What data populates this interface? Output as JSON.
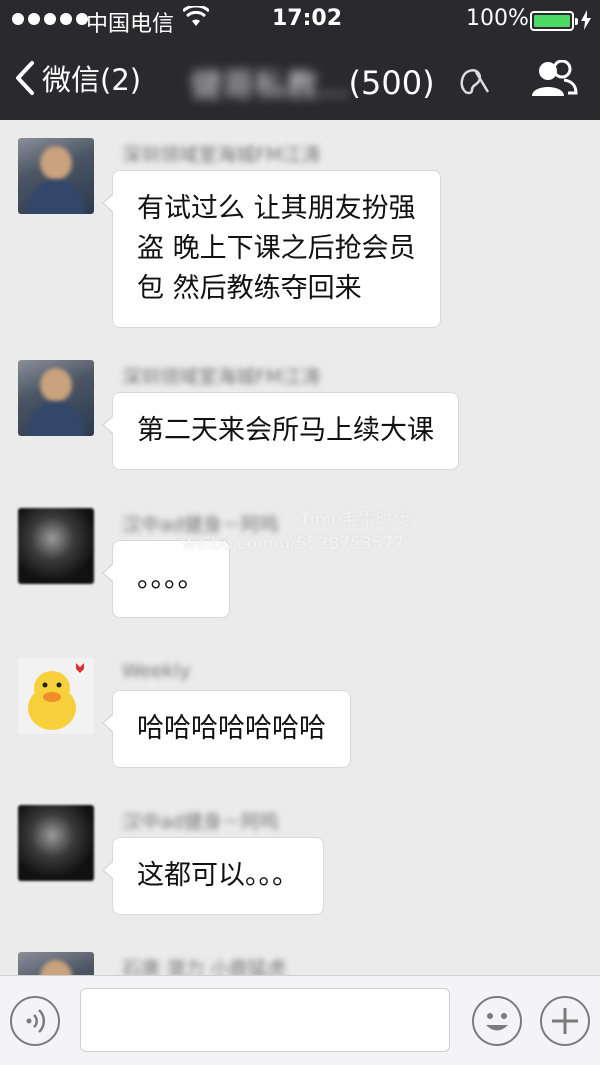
{
  "status_bar": {
    "carrier": "中国电信",
    "time": "17:02",
    "battery_percent": "100%",
    "battery_level": 1.0,
    "battery_color": "#4cd964"
  },
  "nav": {
    "back_label": "微信(2)",
    "group_name": "健哥私教...",
    "member_count": "(500)",
    "icons": [
      "back-chevron-icon",
      "earpiece-muted-icon",
      "group-members-icon"
    ]
  },
  "messages": [
    {
      "sender": "深圳领域室海城FM江涛",
      "text": "有试过么 让其朋友扮强\n盗 晚上下课之后抢会员\n包 然后教练夺回来"
    },
    {
      "sender": "深圳领域室海城FM江涛",
      "text": "第二天来会所马上续大课"
    },
    {
      "sender": "汉中ad健身－阿鸣",
      "text": "。。。。"
    },
    {
      "sender": "Weekly",
      "text": "哈哈哈哈哈哈哈"
    },
    {
      "sender": "汉中ad健身－阿鸣",
      "text": "这都可以。。。"
    },
    {
      "sender": "石唐 潜力 小鹿猛虎",
      "text": ""
    }
  ],
  "watermark": {
    "line1": "Time毛雷时代",
    "line2": "weibo.com/u/5538753577"
  },
  "input_bar": {
    "placeholder": "",
    "icons": [
      "voice-icon",
      "emoji-icon",
      "plus-icon"
    ]
  },
  "colors": {
    "nav_background": "#2a2a2e",
    "chat_background": "#ebebeb",
    "bubble_background": "#ffffff"
  }
}
